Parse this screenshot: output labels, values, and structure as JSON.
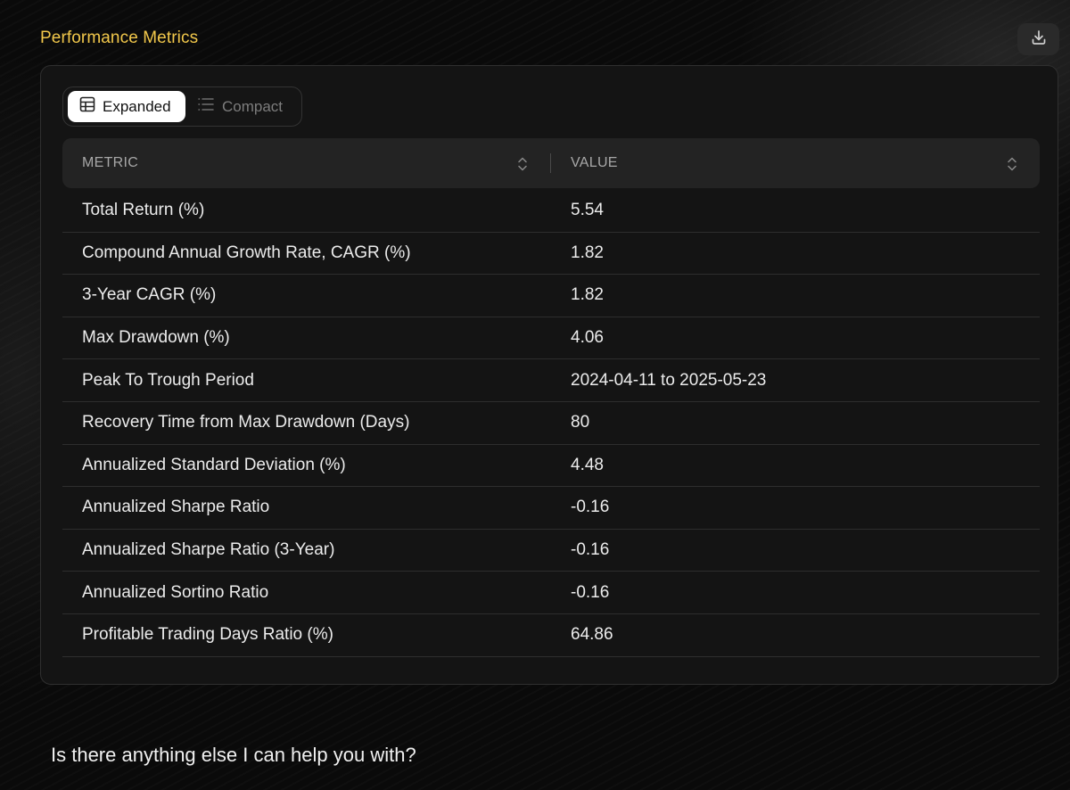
{
  "section": {
    "title": "Performance Metrics",
    "download_icon": "download-icon"
  },
  "view_toggle": {
    "expanded_label": "Expanded",
    "expanded_icon": "table-grid-icon",
    "compact_label": "Compact",
    "compact_icon": "list-icon",
    "active": "Expanded"
  },
  "table": {
    "columns": [
      {
        "label": "METRIC",
        "sort_icon": "sort-updown-icon"
      },
      {
        "label": "VALUE",
        "sort_icon": "sort-updown-icon"
      }
    ],
    "rows": [
      {
        "metric": "Total Return (%)",
        "value": "5.54"
      },
      {
        "metric": "Compound Annual Growth Rate, CAGR (%)",
        "value": "1.82"
      },
      {
        "metric": "3-Year CAGR (%)",
        "value": "1.82"
      },
      {
        "metric": "Max Drawdown (%)",
        "value": "4.06"
      },
      {
        "metric": "Peak To Trough Period",
        "value": "2024-04-11 to 2025-05-23"
      },
      {
        "metric": "Recovery Time from Max Drawdown (Days)",
        "value": "80"
      },
      {
        "metric": "Annualized Standard Deviation (%)",
        "value": "4.48"
      },
      {
        "metric": "Annualized Sharpe Ratio",
        "value": "-0.16"
      },
      {
        "metric": "Annualized Sharpe Ratio (3-Year)",
        "value": "-0.16"
      },
      {
        "metric": "Annualized Sortino Ratio",
        "value": "-0.16"
      },
      {
        "metric": "Profitable Trading Days Ratio (%)",
        "value": "64.86"
      }
    ]
  },
  "followup": {
    "text": "Is there anything else I can help you with?"
  },
  "colors": {
    "accent": "#f2c84b",
    "background": "#0a0a0a",
    "card": "#141414",
    "header_row": "#232323"
  }
}
